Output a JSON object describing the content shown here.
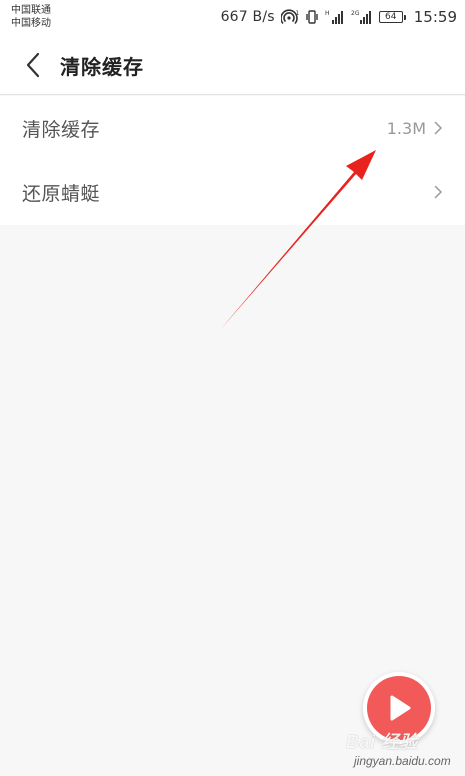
{
  "status_bar": {
    "carrier_1": "中国联通",
    "carrier_2": "中国移动",
    "net_speed": "667 B/s",
    "battery_level": "64",
    "time": "15:59"
  },
  "header": {
    "title": "清除缓存",
    "back_icon": "chevron-left-icon"
  },
  "settings": {
    "items": [
      {
        "label": "清除缓存",
        "value": "1.3M",
        "icon": "chevron-right-icon"
      },
      {
        "label": "还原蜻蜓",
        "value": "",
        "icon": "chevron-right-icon"
      }
    ]
  },
  "fab": {
    "icon": "play-icon",
    "color": "#f25a5a"
  },
  "watermark": {
    "brand": "Bai  经验",
    "sub": "jingyan.baidu.com"
  },
  "colors": {
    "arrow": "#e8231e",
    "background": "#f7f7f7",
    "surface": "#ffffff"
  }
}
